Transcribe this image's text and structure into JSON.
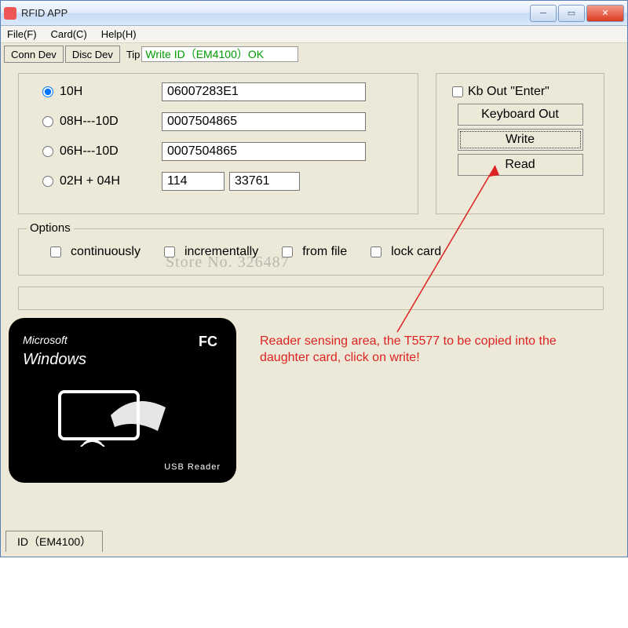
{
  "window": {
    "title": "RFID APP"
  },
  "menu": {
    "file": "File(F)",
    "card": "Card(C)",
    "help": "Help(H)"
  },
  "toolbar": {
    "conn": "Conn Dev",
    "disc": "Disc Dev",
    "tip_label": "Tip",
    "tip_value": "Write ID（EM4100）OK"
  },
  "formats": {
    "r1": {
      "label": "10H",
      "value": "06007283E1",
      "selected": true
    },
    "r2": {
      "label": "08H---10D",
      "value": "0007504865",
      "selected": false
    },
    "r3": {
      "label": "06H---10D",
      "value": "0007504865",
      "selected": false
    },
    "r4": {
      "label": "02H + 04H",
      "value_a": "114",
      "value_b": "33761",
      "selected": false
    }
  },
  "actions": {
    "kb_enter_label": "Kb Out \"Enter\"",
    "keyboard_out": "Keyboard Out",
    "write": "Write",
    "read": "Read"
  },
  "options": {
    "legend": "Options",
    "continuously": "continuously",
    "incrementally": "incrementally",
    "from_file": "from file",
    "lock_card": "lock card"
  },
  "watermark": "Store No. 326487",
  "annotation": "Reader sensing area, the T5577 to be copied into the daughter card, click on write!",
  "reader": {
    "brand_small": "Microsoft",
    "brand_big": "Windows",
    "fc": "FC",
    "label": "USB Reader"
  },
  "bottom_tab": "ID（EM4100）"
}
